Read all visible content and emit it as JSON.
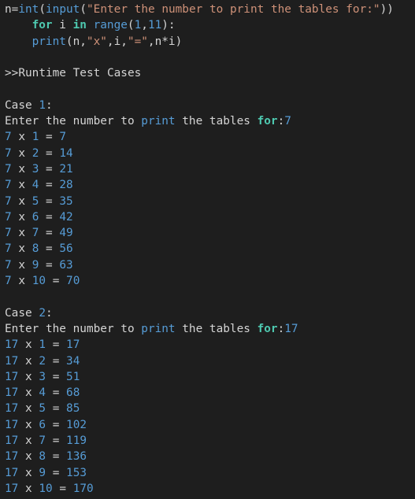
{
  "code": {
    "line1": {
      "var": "n",
      "eq": "=",
      "int_fn": "int",
      "paren_open": "(",
      "input_fn": "input",
      "paren_open2": "(",
      "prompt_str": "\"Enter the number to print the tables for:\"",
      "paren_close": "))"
    },
    "line2": {
      "for_kw": "for",
      "var": " i ",
      "in_kw": "in",
      "sp": " ",
      "range_fn": "range",
      "paren_open": "(",
      "start": "1",
      "comma": ",",
      "end": "11",
      "paren_close": "):"
    },
    "line3": {
      "print_fn": "print",
      "args_a": "(n,",
      "x_str": "\"x\"",
      "args_b": ",i,",
      "eq_str": "\"=\"",
      "args_c": ",n*i)"
    }
  },
  "runtime_header": ">>Runtime Test Cases",
  "prompt": {
    "enter": "Enter the number to ",
    "print_word": "print",
    "mid": " the tables ",
    "for_word": "for",
    "colon": ":"
  },
  "cases": [
    {
      "label": "Case ",
      "number": "1",
      "colon": ":",
      "input": "7",
      "rows": [
        {
          "n": "7",
          "x": "x",
          "i": "1",
          "eq": "=",
          "r": "7"
        },
        {
          "n": "7",
          "x": "x",
          "i": "2",
          "eq": "=",
          "r": "14"
        },
        {
          "n": "7",
          "x": "x",
          "i": "3",
          "eq": "=",
          "r": "21"
        },
        {
          "n": "7",
          "x": "x",
          "i": "4",
          "eq": "=",
          "r": "28"
        },
        {
          "n": "7",
          "x": "x",
          "i": "5",
          "eq": "=",
          "r": "35"
        },
        {
          "n": "7",
          "x": "x",
          "i": "6",
          "eq": "=",
          "r": "42"
        },
        {
          "n": "7",
          "x": "x",
          "i": "7",
          "eq": "=",
          "r": "49"
        },
        {
          "n": "7",
          "x": "x",
          "i": "8",
          "eq": "=",
          "r": "56"
        },
        {
          "n": "7",
          "x": "x",
          "i": "9",
          "eq": "=",
          "r": "63"
        },
        {
          "n": "7",
          "x": "x",
          "i": "10",
          "eq": "=",
          "r": "70"
        }
      ]
    },
    {
      "label": "Case ",
      "number": "2",
      "colon": ":",
      "input": "17",
      "rows": [
        {
          "n": "17",
          "x": "x",
          "i": "1",
          "eq": "=",
          "r": "17"
        },
        {
          "n": "17",
          "x": "x",
          "i": "2",
          "eq": "=",
          "r": "34"
        },
        {
          "n": "17",
          "x": "x",
          "i": "3",
          "eq": "=",
          "r": "51"
        },
        {
          "n": "17",
          "x": "x",
          "i": "4",
          "eq": "=",
          "r": "68"
        },
        {
          "n": "17",
          "x": "x",
          "i": "5",
          "eq": "=",
          "r": "85"
        },
        {
          "n": "17",
          "x": "x",
          "i": "6",
          "eq": "=",
          "r": "102"
        },
        {
          "n": "17",
          "x": "x",
          "i": "7",
          "eq": "=",
          "r": "119"
        },
        {
          "n": "17",
          "x": "x",
          "i": "8",
          "eq": "=",
          "r": "136"
        },
        {
          "n": "17",
          "x": "x",
          "i": "9",
          "eq": "=",
          "r": "153"
        },
        {
          "n": "17",
          "x": "x",
          "i": "10",
          "eq": "=",
          "r": "170"
        }
      ]
    }
  ],
  "colors": {
    "background": "#1e1e1e",
    "text": "#d4d4d4",
    "keyword": "#569cd6",
    "string": "#ce9178",
    "accent_keyword": "#4ec9b0"
  }
}
